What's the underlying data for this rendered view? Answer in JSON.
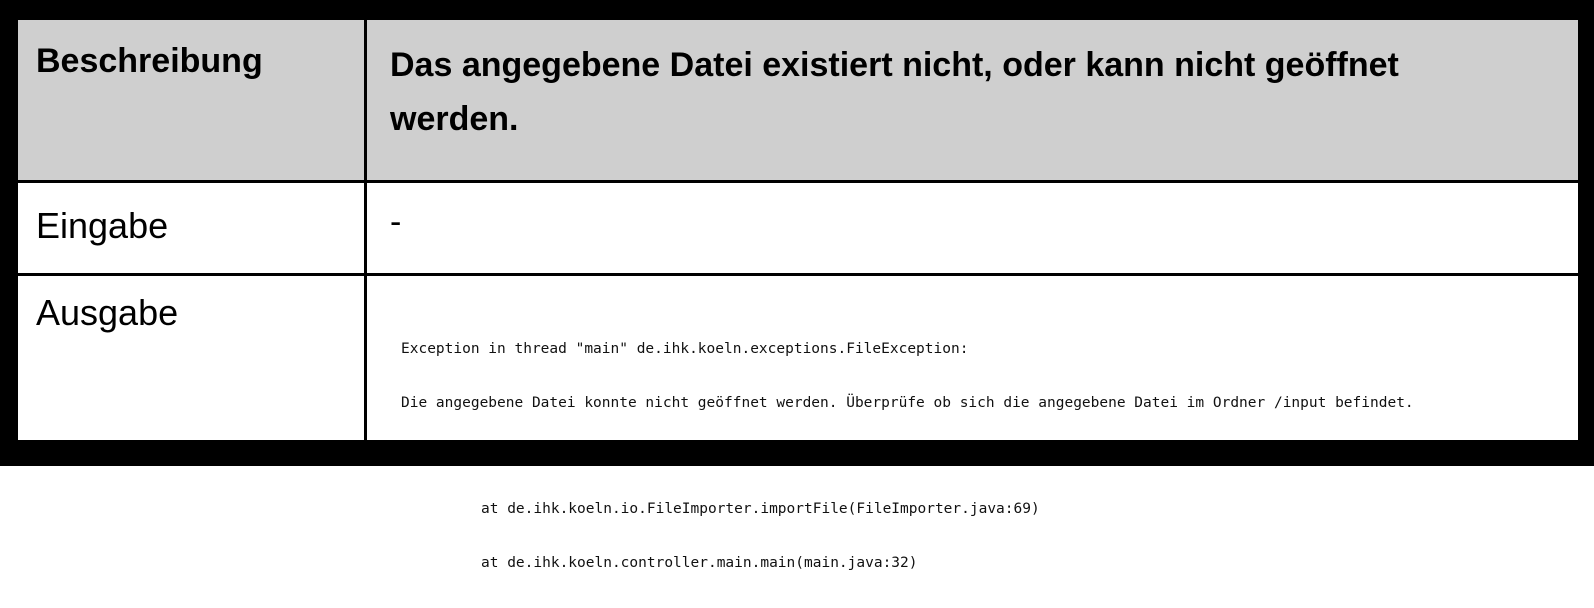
{
  "rows": {
    "header": {
      "label": "Beschreibung",
      "value": "Das angegebene Datei existiert nicht, oder kann nicht geöffnet werden."
    },
    "input": {
      "label": "Eingabe",
      "value": "-"
    },
    "output": {
      "label": "Ausgabe",
      "console": {
        "line1": "Exception in thread \"main\" de.ihk.koeln.exceptions.FileException:",
        "line2": "Die angegebene Datei konnte nicht geöffnet werden. Überprüfe ob sich die angegebene Datei im Ordner /input befindet.",
        "stack": [
          "at de.ihk.koeln.io.FileImporter.importFile(FileImporter.java:69)",
          "at de.ihk.koeln.controller.main.main(main.java:32)"
        ]
      }
    }
  },
  "colors": {
    "border": "#000000",
    "header_background": "#cfcfcf",
    "body_background": "#ffffff"
  }
}
